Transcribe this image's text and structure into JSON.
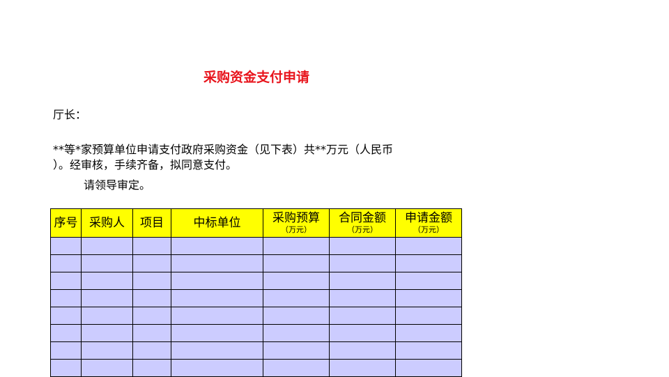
{
  "document": {
    "title": "采购资金支付申请",
    "salutation": "厅长：",
    "body_line_1": "**等*家预算单位申请支付政府采购资金（见下表）共**万元（人民币",
    "body_line_2": "）。经审核，手续齐备，拟同意支付。",
    "body_line_3": "请领导审定。"
  },
  "table": {
    "columns": [
      {
        "label": "序号",
        "unit": ""
      },
      {
        "label": "采购人",
        "unit": ""
      },
      {
        "label": "项目",
        "unit": ""
      },
      {
        "label": "中标单位",
        "unit": ""
      },
      {
        "label": "采购预算",
        "unit": "（万元）"
      },
      {
        "label": "合同金额",
        "unit": "（万元）"
      },
      {
        "label": "申请金额",
        "unit": "（万元）"
      }
    ],
    "empty_row_count": 8
  },
  "colors": {
    "title": "#e8141c",
    "header_bg": "#ffff00",
    "cell_bg": "#ccccff"
  }
}
